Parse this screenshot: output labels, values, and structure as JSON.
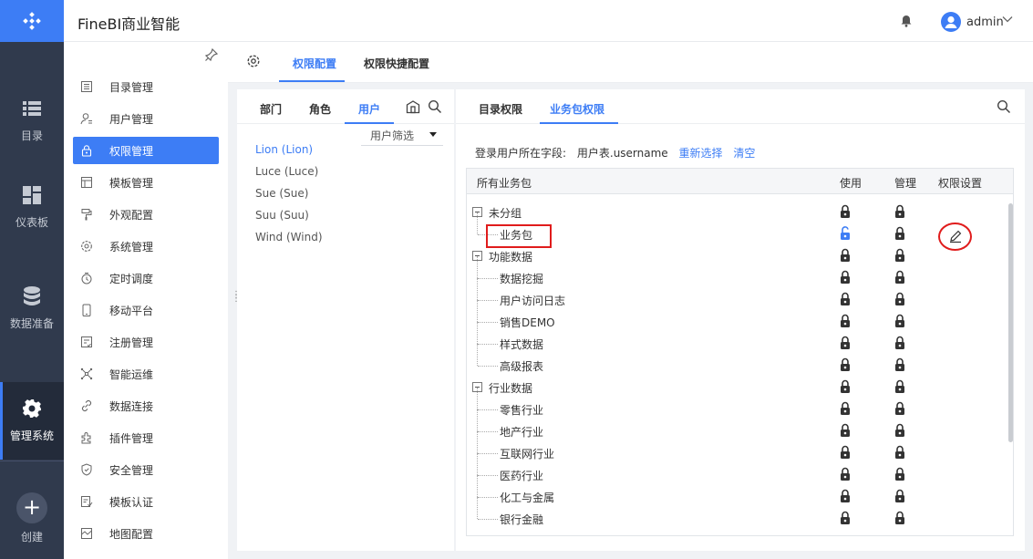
{
  "header": {
    "app_title": "FineBI商业智能",
    "user": "admin"
  },
  "rail": {
    "items": [
      {
        "label": "目录",
        "icon": "list-icon"
      },
      {
        "label": "仪表板",
        "icon": "dashboard-icon"
      },
      {
        "label": "数据准备",
        "icon": "database-icon"
      },
      {
        "label": "管理系统",
        "icon": "gear-icon",
        "active": true
      }
    ],
    "create_label": "创建"
  },
  "menu": {
    "items": [
      {
        "label": "目录管理",
        "icon": "catalog-icon"
      },
      {
        "label": "用户管理",
        "icon": "user-icon"
      },
      {
        "label": "权限管理",
        "icon": "lock-icon",
        "active": true
      },
      {
        "label": "模板管理",
        "icon": "template-icon"
      },
      {
        "label": "外观配置",
        "icon": "brush-icon"
      },
      {
        "label": "系统管理",
        "icon": "settings-icon"
      },
      {
        "label": "定时调度",
        "icon": "timer-icon"
      },
      {
        "label": "移动平台",
        "icon": "mobile-icon"
      },
      {
        "label": "注册管理",
        "icon": "register-icon"
      },
      {
        "label": "智能运维",
        "icon": "ops-icon"
      },
      {
        "label": "数据连接",
        "icon": "link-icon"
      },
      {
        "label": "插件管理",
        "icon": "plugin-icon"
      },
      {
        "label": "安全管理",
        "icon": "shield-icon"
      },
      {
        "label": "模板认证",
        "icon": "cert-icon"
      },
      {
        "label": "地图配置",
        "icon": "map-icon"
      }
    ]
  },
  "main_tabs": [
    "权限配置",
    "权限快捷配置"
  ],
  "left_panel": {
    "tabs": [
      "部门",
      "角色",
      "用户"
    ],
    "filter_label": "用户筛选",
    "users": [
      "Lion (Lion)",
      "Luce (Luce)",
      "Sue (Sue)",
      "Suu (Suu)",
      "Wind (Wind)"
    ]
  },
  "right_panel": {
    "tabs": [
      "目录权限",
      "业务包权限"
    ],
    "login_label": "登录用户所在字段:",
    "login_value": "用户表.username",
    "reselect": "重新选择",
    "clear": "清空",
    "columns": [
      "所有业务包",
      "使用",
      "管理",
      "权限设置"
    ],
    "rows": [
      {
        "label": "未分组",
        "level": 0
      },
      {
        "label": "业务包",
        "level": 1,
        "use_unlocked": true
      },
      {
        "label": "功能数据",
        "level": 0
      },
      {
        "label": "数据挖掘",
        "level": 1
      },
      {
        "label": "用户访问日志",
        "level": 1
      },
      {
        "label": "销售DEMO",
        "level": 1
      },
      {
        "label": "样式数据",
        "level": 1
      },
      {
        "label": "高级报表",
        "level": 1
      },
      {
        "label": "行业数据",
        "level": 0
      },
      {
        "label": "零售行业",
        "level": 1
      },
      {
        "label": "地产行业",
        "level": 1
      },
      {
        "label": "互联网行业",
        "level": 1
      },
      {
        "label": "医药行业",
        "level": 1
      },
      {
        "label": "化工与金属",
        "level": 1
      },
      {
        "label": "银行金融",
        "level": 1
      }
    ]
  },
  "colors": {
    "accent": "#3d7df5",
    "rail": "#303a4d",
    "highlight": "#e01c1c"
  }
}
